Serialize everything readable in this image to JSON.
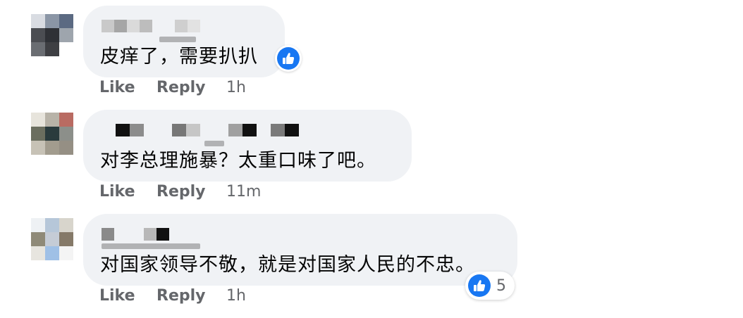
{
  "comments": [
    {
      "text": "皮痒了，需要扒扒",
      "reaction_icon": "thumbs-up-icon",
      "actions": {
        "like": "Like",
        "reply": "Reply",
        "time": "1h"
      }
    },
    {
      "text": "对李总理施暴？太重口味了吧。",
      "actions": {
        "like": "Like",
        "reply": "Reply",
        "time": "11m"
      }
    },
    {
      "text": "对国家领导不敬，就是对国家人民的不忠。",
      "reaction_icon": "thumbs-up-icon",
      "reaction_count": "5",
      "actions": {
        "like": "Like",
        "reply": "Reply",
        "time": "1h"
      }
    }
  ],
  "colors": {
    "bubble": "#f0f2f5",
    "action_text": "#65676b",
    "like_blue": "#1877f2",
    "text": "#050505"
  }
}
